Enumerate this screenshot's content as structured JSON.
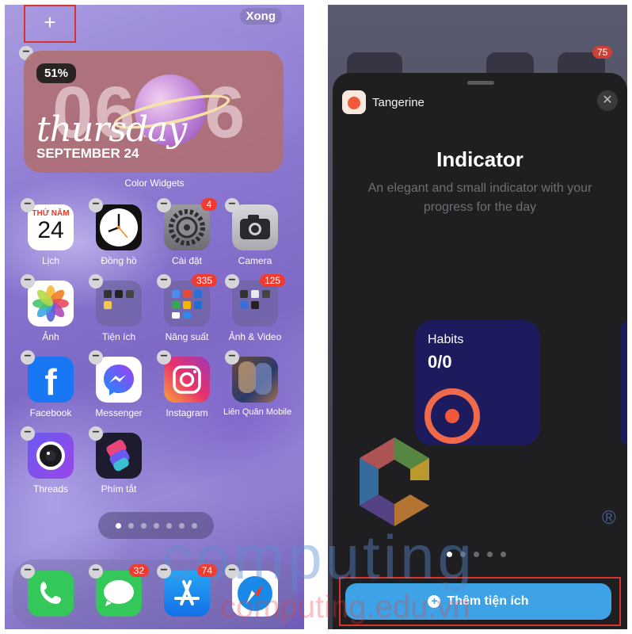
{
  "home_screen": {
    "add_button": "+",
    "done_button": "Xong",
    "widget": {
      "battery": "51%",
      "time": "06:36",
      "day": "thursday",
      "date": "SEPTEMBER 24",
      "caption": "Color Widgets"
    },
    "apps": [
      {
        "label": "Lịch",
        "icon": "calendar-icon",
        "calendar_header": "THỨ NĂM",
        "calendar_day": "24"
      },
      {
        "label": "Đồng hồ",
        "icon": "clock-icon"
      },
      {
        "label": "Cài đặt",
        "icon": "settings-icon",
        "badge": "4"
      },
      {
        "label": "Camera",
        "icon": "camera-icon"
      },
      {
        "label": "Ảnh",
        "icon": "photos-icon"
      },
      {
        "label": "Tiện ích",
        "icon": "folder-icon"
      },
      {
        "label": "Năng suất",
        "icon": "folder-icon",
        "badge": "335"
      },
      {
        "label": "Ảnh & Video",
        "icon": "folder-icon",
        "badge": "125"
      },
      {
        "label": "Facebook",
        "icon": "facebook-icon"
      },
      {
        "label": "Messenger",
        "icon": "messenger-icon"
      },
      {
        "label": "Instagram",
        "icon": "instagram-icon"
      },
      {
        "label": "Liên Quân Mobile",
        "icon": "game-icon"
      },
      {
        "label": "Threads",
        "icon": "threads-icon"
      },
      {
        "label": "Phím tắt",
        "icon": "shortcuts-icon"
      }
    ],
    "dock": [
      {
        "icon": "phone-icon"
      },
      {
        "icon": "messages-icon",
        "badge": "32"
      },
      {
        "icon": "app-store-icon",
        "badge": "74"
      },
      {
        "icon": "safari-icon"
      }
    ]
  },
  "widget_sheet": {
    "background_badge": "75",
    "app_name": "Tangerine",
    "title": "Indicator",
    "description": "An elegant and small indicator with your progress for the day",
    "preview": {
      "title": "Habits",
      "count": "0/0"
    },
    "add_button": "Thêm tiện ích"
  },
  "watermark": {
    "brand": "computing",
    "url": "computing.edu.vn",
    "registered": "®"
  },
  "colors": {
    "wallpaper": "#8c79d2",
    "widget_bg": "#b06e70",
    "sheet_bg": "#1f1f22",
    "preview_bg": "#1d1b5e",
    "accent_orange": "#f06a4a",
    "button_blue": "#3ea3e6",
    "highlight_red": "#d9342b",
    "badge_red": "#f23b30"
  }
}
